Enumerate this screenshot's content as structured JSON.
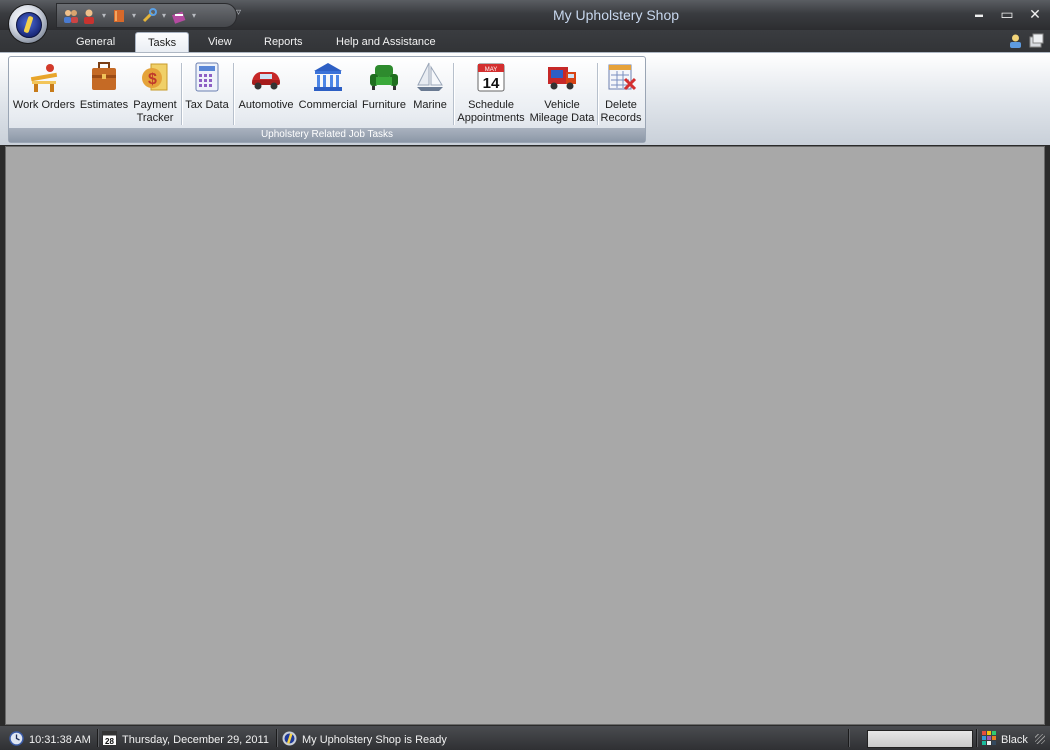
{
  "window": {
    "title": "My Upholstery Shop",
    "minimize": "▬",
    "maximize": "▭",
    "close": "✕"
  },
  "quick_access": {
    "buttons": [
      "customers-icon",
      "employee-icon",
      "book-icon",
      "tools-icon",
      "notes-icon"
    ],
    "more": "▿"
  },
  "tabs": [
    {
      "label": "General",
      "active": false
    },
    {
      "label": "Tasks",
      "active": true
    },
    {
      "label": "View",
      "active": false
    },
    {
      "label": "Reports",
      "active": false
    },
    {
      "label": "Help and Assistance",
      "active": false
    }
  ],
  "ribbon": {
    "group_label": "Upholstery Related Job Tasks",
    "buttons": [
      {
        "label": "Work Orders",
        "icon": "work-orders-icon"
      },
      {
        "label": "Estimates",
        "icon": "briefcase-icon"
      },
      {
        "label": "Payment\nTracker",
        "icon": "payment-icon"
      },
      {
        "label": "Tax Data",
        "icon": "calculator-icon"
      },
      {
        "label": "Automotive",
        "icon": "car-icon"
      },
      {
        "label": "Commercial",
        "icon": "building-icon"
      },
      {
        "label": "Furniture",
        "icon": "sofa-icon"
      },
      {
        "label": "Marine",
        "icon": "sailboat-icon"
      },
      {
        "label": "Schedule\nAppointments",
        "icon": "calendar-icon",
        "calendar_month": "MAY",
        "calendar_day": "14"
      },
      {
        "label": "Vehicle\nMileage Data",
        "icon": "truck-icon"
      },
      {
        "label": "Delete\nRecords",
        "icon": "delete-records-icon"
      }
    ]
  },
  "status": {
    "time": "10:31:38 AM",
    "date_icon_day": "28",
    "date": "Thursday, December 29, 2011",
    "message": "My Upholstery Shop is Ready",
    "theme": "Black"
  }
}
